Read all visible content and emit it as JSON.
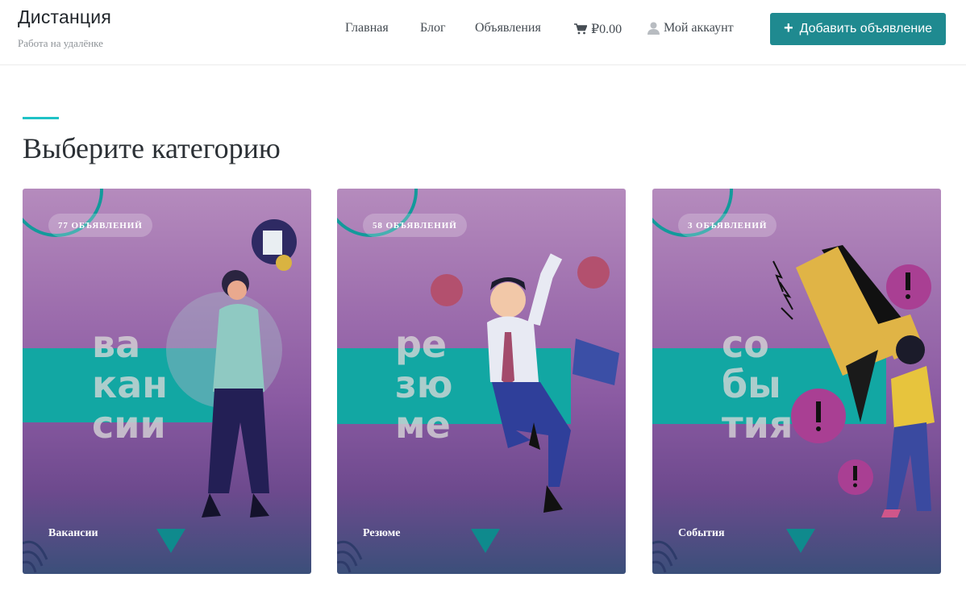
{
  "brand": {
    "title": "Дистанция",
    "tagline": "Работа на удалёнке"
  },
  "nav": {
    "home": "Главная",
    "blog": "Блог",
    "listings": "Объявления",
    "cart_total": "₽0.00",
    "account": "Мой аккаунт",
    "add_listing": "Добавить объявление"
  },
  "section": {
    "title": "Выберите категорию"
  },
  "cards": [
    {
      "badge": "77 ОБЪЯВЛЕНИЙ",
      "label": "Вакансии",
      "word_lines": [
        "ва",
        "кан",
        "сии"
      ]
    },
    {
      "badge": "58 ОБЪЯВЛЕНИЙ",
      "label": "Резюме",
      "word_lines": [
        "ре",
        "зю",
        "ме"
      ]
    },
    {
      "badge": "3 ОБЪЯВЛЕНИЙ",
      "label": "События",
      "word_lines": [
        "со",
        "бы",
        "тия"
      ]
    }
  ],
  "colors": {
    "accent": "#1fc2c6",
    "button": "#1f8a90",
    "teal_stripe": "#12a7a3"
  },
  "icons": {
    "cart": "cart-icon",
    "user": "user-icon",
    "plus": "plus-icon"
  }
}
